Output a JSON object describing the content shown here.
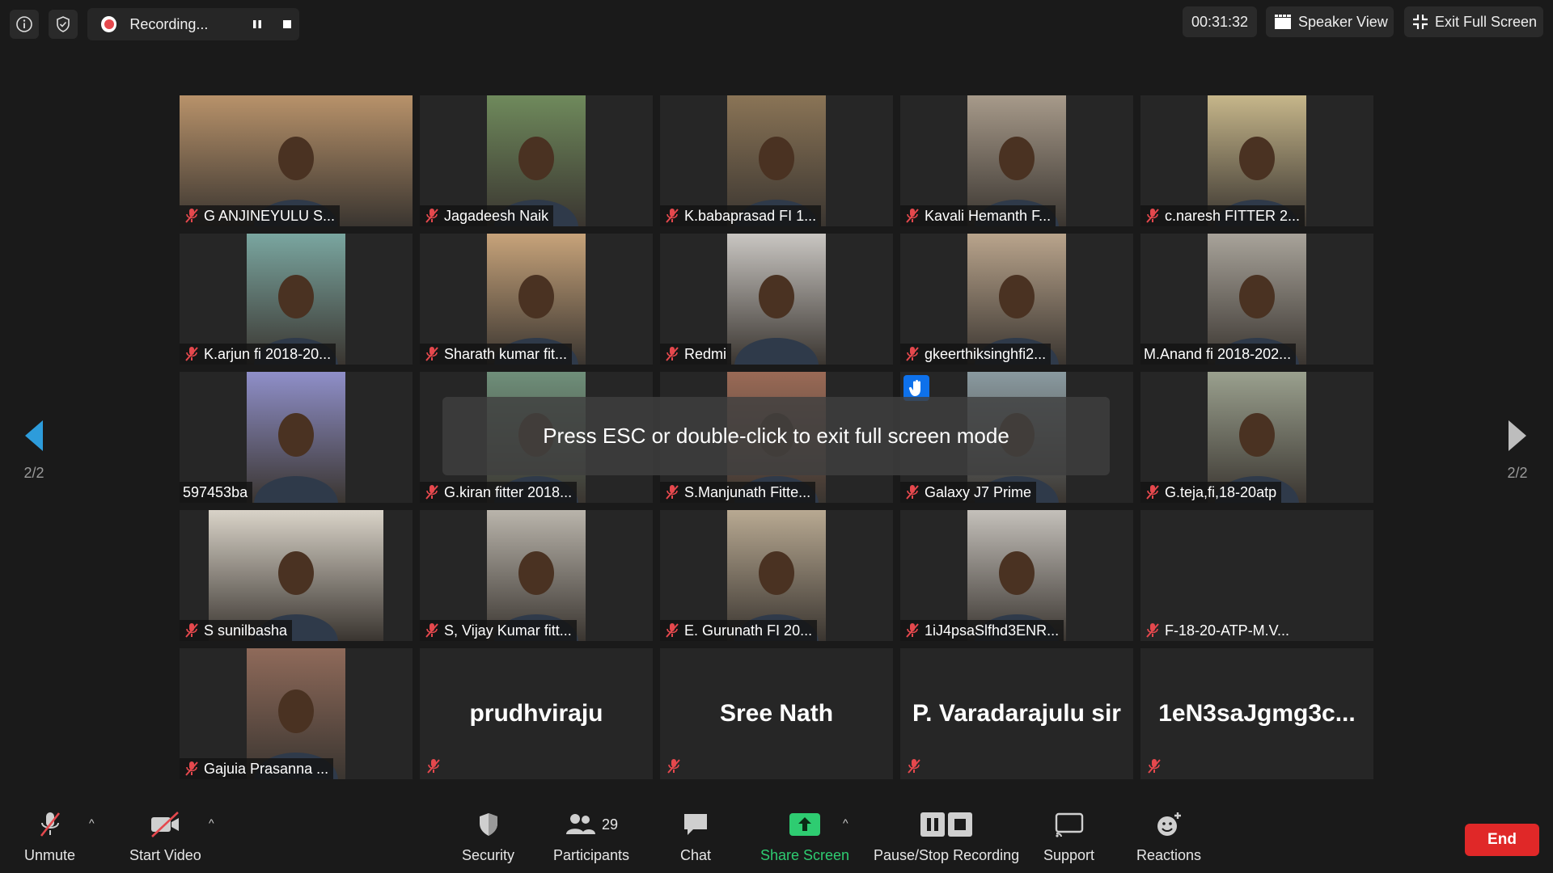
{
  "topbar": {
    "recording_text": "Recording...",
    "timer": "00:31:32",
    "speaker_view_label": "Speaker View",
    "exit_fullscreen_label": "Exit Full Screen"
  },
  "toast": {
    "text": "Press ESC or double-click to exit full screen mode"
  },
  "pagination": {
    "left": "2/2",
    "right": "2/2"
  },
  "participants": [
    {
      "name": "G ANJINEYULU S...",
      "muted": true,
      "video": true,
      "tone": "#b8926a"
    },
    {
      "name": "Jagadeesh Naik",
      "muted": true,
      "video": true,
      "tone": "#6f8a5c"
    },
    {
      "name": "K.babaprasad FI 1...",
      "muted": true,
      "video": true,
      "tone": "#8a7456"
    },
    {
      "name": "Kavali Hemanth F...",
      "muted": true,
      "video": true,
      "tone": "#a79a8a"
    },
    {
      "name": "c.naresh FITTER 2...",
      "muted": true,
      "video": true,
      "tone": "#c6b68a"
    },
    {
      "name": "K.arjun fi 2018-20...",
      "muted": true,
      "video": true,
      "tone": "#7aa6a0"
    },
    {
      "name": "Sharath kumar fit...",
      "muted": true,
      "video": true,
      "tone": "#c7a37a"
    },
    {
      "name": "Redmi",
      "muted": true,
      "video": true,
      "tone": "#c9c6c2"
    },
    {
      "name": "gkeerthiksinghfi2...",
      "muted": true,
      "video": true,
      "tone": "#b9a48c"
    },
    {
      "name": "M.Anand fi 2018-202...",
      "muted": false,
      "video": true,
      "tone": "#a8a39a"
    },
    {
      "name": "597453ba",
      "muted": false,
      "video": true,
      "tone": "#8f8fc9"
    },
    {
      "name": "G.kiran fitter 2018...",
      "muted": true,
      "video": true,
      "tone": "#6f8f7a"
    },
    {
      "name": "S.Manjunath Fitte...",
      "muted": true,
      "video": true,
      "tone": "#9a6a56"
    },
    {
      "name": "Galaxy J7 Prime",
      "muted": true,
      "video": true,
      "tone": "#8a9aa0",
      "hand_raised": true
    },
    {
      "name": "G.teja,fi,18-20atp",
      "muted": true,
      "video": true,
      "tone": "#9aa08e"
    },
    {
      "name": "S sunilbasha",
      "muted": true,
      "video": true,
      "tone": "#d9d3c8"
    },
    {
      "name": "S, Vijay Kumar fitt...",
      "muted": true,
      "video": true,
      "tone": "#b9b4ab"
    },
    {
      "name": "E. Gurunath FI 20...",
      "muted": true,
      "video": true,
      "tone": "#b8a992"
    },
    {
      "name": "1iJ4psaSlfhd3ENR...",
      "muted": true,
      "video": true,
      "tone": "#c4c0ba"
    },
    {
      "name": "F-18-20-ATP-M.V...",
      "muted": true,
      "video": false
    },
    {
      "name": "Gajuia Prasanna ...",
      "muted": true,
      "video": true,
      "tone": "#8f6a5a"
    },
    {
      "name": "prudhviraju",
      "muted": true,
      "video": false,
      "big": true
    },
    {
      "name": "Sree Nath",
      "muted": true,
      "video": false,
      "big": true
    },
    {
      "name": "P. Varadarajulu sir",
      "muted": true,
      "video": false,
      "big": true
    },
    {
      "name": "1eN3saJgmg3c...",
      "muted": true,
      "video": false,
      "big": true
    }
  ],
  "toolbar": {
    "unmute": "Unmute",
    "start_video": "Start Video",
    "security": "Security",
    "participants": "Participants",
    "participants_count": "29",
    "chat": "Chat",
    "share_screen": "Share Screen",
    "pause_stop_recording": "Pause/Stop Recording",
    "support": "Support",
    "reactions": "Reactions",
    "end": "End"
  },
  "colors": {
    "share": "#2ecc71",
    "end": "#e02828",
    "accent": "#0e71eb",
    "mute": "#e5484d"
  }
}
